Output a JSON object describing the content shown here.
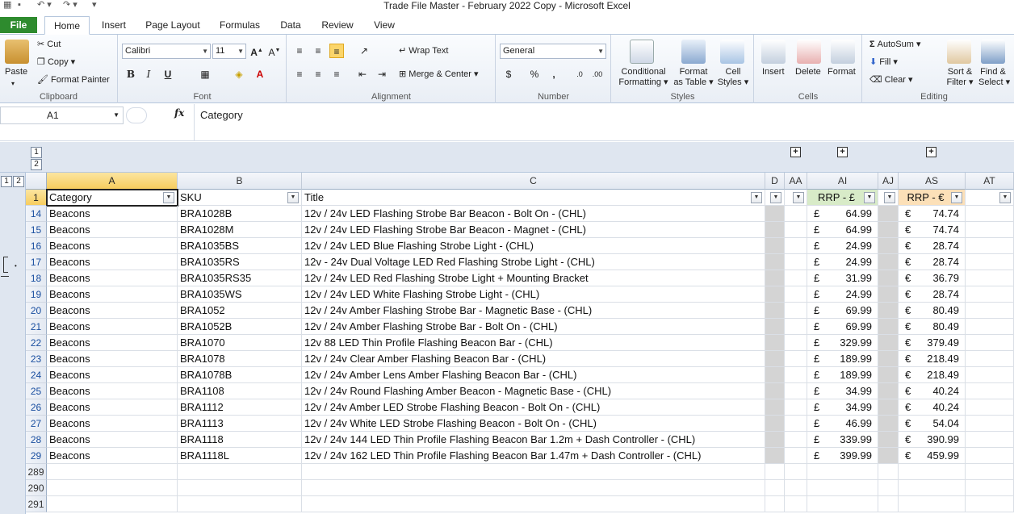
{
  "window": {
    "title": "Trade File Master - February 2022 Copy  -  Microsoft Excel"
  },
  "ribbon": {
    "tabs": [
      "File",
      "Home",
      "Insert",
      "Page Layout",
      "Formulas",
      "Data",
      "Review",
      "View"
    ],
    "active_tab": "Home",
    "clipboard": {
      "paste": "Paste",
      "cut": "Cut",
      "copy": "Copy",
      "format_painter": "Format Painter",
      "label": "Clipboard"
    },
    "font": {
      "name": "Calibri",
      "size": "11",
      "label": "Font",
      "bold": "B",
      "italic": "I",
      "underline": "U"
    },
    "alignment": {
      "wrap_text": "Wrap Text",
      "merge_center": "Merge & Center",
      "label": "Alignment"
    },
    "number": {
      "format": "General",
      "percent": "%",
      "comma": ",",
      "label": "Number"
    },
    "styles": {
      "conditional_1": "Conditional",
      "conditional_2": "Formatting",
      "format_table_1": "Format",
      "format_table_2": "as Table",
      "cell_styles_1": "Cell",
      "cell_styles_2": "Styles",
      "label": "Styles"
    },
    "cells": {
      "insert": "Insert",
      "delete": "Delete",
      "format": "Format",
      "label": "Cells"
    },
    "editing": {
      "autosum": "AutoSum",
      "fill": "Fill",
      "clear": "Clear",
      "sort_1": "Sort &",
      "sort_2": "Filter",
      "find_1": "Find &",
      "find_2": "Select",
      "label": "Editing"
    }
  },
  "formula_bar": {
    "name_box": "A1",
    "fx": "fx",
    "content": "Category"
  },
  "outline": {
    "column_levels": [
      "1",
      "2"
    ],
    "row_levels": [
      "1",
      "2"
    ],
    "expand_symbol": "+"
  },
  "columns": {
    "A": "A",
    "B": "B",
    "C": "C",
    "D": "D",
    "AA": "AA",
    "AI": "AI",
    "AJ": "AJ",
    "AS": "AS",
    "AT": "AT"
  },
  "header_row": {
    "row_number": "1",
    "category": "Category",
    "sku": "SKU",
    "title": "Title",
    "rrp_gbp": "RRP - £",
    "rrp_eur": "RRP - €"
  },
  "rows": [
    {
      "n": "14",
      "category": "Beacons",
      "sku": "BRA1028B",
      "title": "12v / 24v LED Flashing Strobe Bar Beacon - Bolt On - (CHL)",
      "gbp_symbol": "£",
      "gbp": "64.99",
      "eur_symbol": "€",
      "eur": "74.74"
    },
    {
      "n": "15",
      "category": "Beacons",
      "sku": "BRA1028M",
      "title": "12v / 24v LED Flashing Strobe Bar Beacon - Magnet - (CHL)",
      "gbp_symbol": "£",
      "gbp": "64.99",
      "eur_symbol": "€",
      "eur": "74.74"
    },
    {
      "n": "16",
      "category": "Beacons",
      "sku": "BRA1035BS",
      "title": "12v / 24v LED Blue Flashing Strobe Light - (CHL)",
      "gbp_symbol": "£",
      "gbp": "24.99",
      "eur_symbol": "€",
      "eur": "28.74"
    },
    {
      "n": "17",
      "category": "Beacons",
      "sku": "BRA1035RS",
      "title": "12v - 24v Dual Voltage LED Red Flashing Strobe Light - (CHL)",
      "gbp_symbol": "£",
      "gbp": "24.99",
      "eur_symbol": "€",
      "eur": "28.74"
    },
    {
      "n": "18",
      "category": "Beacons",
      "sku": "BRA1035RS35",
      "title": "12v / 24v LED Red Flashing Strobe Light + Mounting Bracket",
      "gbp_symbol": "£",
      "gbp": "31.99",
      "eur_symbol": "€",
      "eur": "36.79"
    },
    {
      "n": "19",
      "category": "Beacons",
      "sku": "BRA1035WS",
      "title": "12v / 24v LED White Flashing Strobe Light - (CHL)",
      "gbp_symbol": "£",
      "gbp": "24.99",
      "eur_symbol": "€",
      "eur": "28.74"
    },
    {
      "n": "20",
      "category": "Beacons",
      "sku": "BRA1052",
      "title": "12v / 24v Amber Flashing Strobe Bar - Magnetic Base - (CHL)",
      "gbp_symbol": "£",
      "gbp": "69.99",
      "eur_symbol": "€",
      "eur": "80.49"
    },
    {
      "n": "21",
      "category": "Beacons",
      "sku": "BRA1052B",
      "title": "12v / 24v Amber Flashing Strobe Bar - Bolt On - (CHL)",
      "gbp_symbol": "£",
      "gbp": "69.99",
      "eur_symbol": "€",
      "eur": "80.49"
    },
    {
      "n": "22",
      "category": "Beacons",
      "sku": "BRA1070",
      "title": "12v 88 LED Thin Profile Flashing Beacon Bar - (CHL)",
      "gbp_symbol": "£",
      "gbp": "329.99",
      "eur_symbol": "€",
      "eur": "379.49"
    },
    {
      "n": "23",
      "category": "Beacons",
      "sku": "BRA1078",
      "title": "12v / 24v Clear Amber Flashing Beacon Bar - (CHL)",
      "gbp_symbol": "£",
      "gbp": "189.99",
      "eur_symbol": "€",
      "eur": "218.49"
    },
    {
      "n": "24",
      "category": "Beacons",
      "sku": "BRA1078B",
      "title": "12v / 24v Amber Lens Amber Flashing Beacon Bar - (CHL)",
      "gbp_symbol": "£",
      "gbp": "189.99",
      "eur_symbol": "€",
      "eur": "218.49"
    },
    {
      "n": "25",
      "category": "Beacons",
      "sku": "BRA1108",
      "title": "12v / 24v Round Flashing Amber Beacon - Magnetic Base - (CHL)",
      "gbp_symbol": "£",
      "gbp": "34.99",
      "eur_symbol": "€",
      "eur": "40.24"
    },
    {
      "n": "26",
      "category": "Beacons",
      "sku": "BRA1112",
      "title": "12v / 24v Amber LED Strobe Flashing Beacon - Bolt On - (CHL)",
      "gbp_symbol": "£",
      "gbp": "34.99",
      "eur_symbol": "€",
      "eur": "40.24"
    },
    {
      "n": "27",
      "category": "Beacons",
      "sku": "BRA1113",
      "title": "12v / 24v White LED Strobe Flashing Beacon - Bolt On - (CHL)",
      "gbp_symbol": "£",
      "gbp": "46.99",
      "eur_symbol": "€",
      "eur": "54.04"
    },
    {
      "n": "28",
      "category": "Beacons",
      "sku": "BRA1118",
      "title": "12v / 24v 144 LED Thin Profile Flashing Beacon Bar 1.2m + Dash Controller - (CHL)",
      "gbp_symbol": "£",
      "gbp": "339.99",
      "eur_symbol": "€",
      "eur": "390.99"
    },
    {
      "n": "29",
      "category": "Beacons",
      "sku": "BRA1118L",
      "title": "12v / 24v 162 LED Thin Profile Flashing Beacon Bar 1.47m + Dash Controller - (CHL)",
      "gbp_symbol": "£",
      "gbp": "399.99",
      "eur_symbol": "€",
      "eur": "459.99"
    }
  ],
  "empty_rows": [
    "289",
    "290",
    "291"
  ],
  "colors": {
    "file_tab": "#2e8b2e",
    "selected_header": "#f7cd5e",
    "rrp_gbp_header": "#d8ebc8",
    "rrp_eur_header": "#fce0b8",
    "hidden_col_fill": "#d4d4d4"
  }
}
